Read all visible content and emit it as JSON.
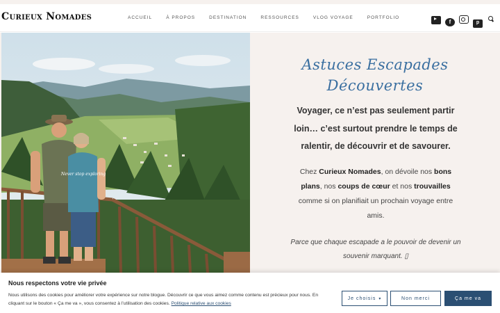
{
  "header": {
    "logo": "Curieux Nomades",
    "menu": [
      "Accueil",
      "À propos",
      "Destination",
      "Ressources",
      "Vlog voyage",
      "Portfolio"
    ],
    "icons": [
      "youtube-icon",
      "facebook-icon",
      "instagram-icon",
      "pinterest-icon",
      "search-icon"
    ]
  },
  "hero": {
    "script_line1": "Astuces Escapades",
    "script_line2": "Découvertes",
    "lead": "Voyager, ce n’est pas seulement partir loin… c’est surtout prendre le temps de ralentir, de découvrir et de savourer.",
    "body": {
      "p1": "Chez ",
      "b1": "Curieux Nomades",
      "p2": ", on dévoile nos ",
      "b2": "bons plans",
      "p3": ", nos ",
      "b3": "coups de cœur",
      "p4": " et nos ",
      "b4": "trouvailles",
      "p5": " comme si on planifiait un prochain voyage entre amis."
    },
    "quote": "Parce que chaque escapade a le pouvoir de devenir un souvenir marquant. ▯",
    "photo_shirt_text": "Never stop exploring"
  },
  "cookie": {
    "title": "Nous respectons votre vie privée",
    "text": "Nous utilisons des cookies pour améliorer votre expérience sur notre blogue. Découvrir ce que vous aimez comme contenu est précieux pour nous. En cliquant sur le bouton « Ça me va », vous consentez à l’utilisation des cookies.",
    "policy_link": "Politique relative aux cookies",
    "btn_choose": "Je choisis",
    "btn_no": "Non merci",
    "btn_yes": "Ça me va"
  },
  "colors": {
    "accent": "#2b4f73",
    "script": "#3a6fa0",
    "hero_bg": "#f6f1ee"
  }
}
